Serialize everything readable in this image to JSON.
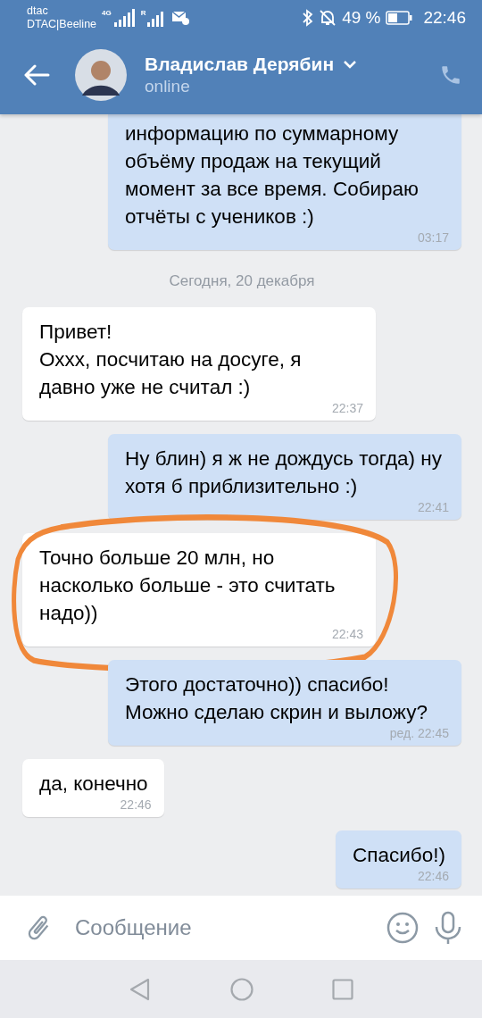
{
  "status_bar": {
    "carrier_1": "dtac",
    "carrier_2": "DTAC|Beeline",
    "network": "4G",
    "roaming": "R",
    "battery": "49 %",
    "time": "22:46"
  },
  "header": {
    "name": "Владислав Дерябин",
    "status": "online"
  },
  "messages": [
    {
      "kind": "outgoing",
      "text": "информацию по суммарному объёму продаж на текущий момент за все время. Собираю отчёты с учеников :)",
      "time": "03:17",
      "cut_top": true
    },
    {
      "kind": "date",
      "text": "Сегодня, 20 декабря"
    },
    {
      "kind": "incoming",
      "text": "Привет!\nОххх, посчитаю на досуге, я давно уже не считал :)",
      "time": "22:37"
    },
    {
      "kind": "outgoing",
      "text": "Ну блин) я ж не дождусь тогда) ну хотя б приблизительно :)",
      "time": "22:41"
    },
    {
      "kind": "incoming",
      "text": "Точно больше 20 млн, но насколько больше - это считать надо))",
      "time": "22:43",
      "highlighted": true
    },
    {
      "kind": "outgoing",
      "text": "Этого достаточно)) спасибо! Можно сделаю скрин и выложу?",
      "time": "ред. 22:45"
    },
    {
      "kind": "incoming",
      "text": "да, конечно",
      "time": "22:46"
    },
    {
      "kind": "outgoing",
      "text": "Спасибо!)",
      "time": "22:46"
    }
  ],
  "composer": {
    "placeholder": "Сообщение"
  }
}
